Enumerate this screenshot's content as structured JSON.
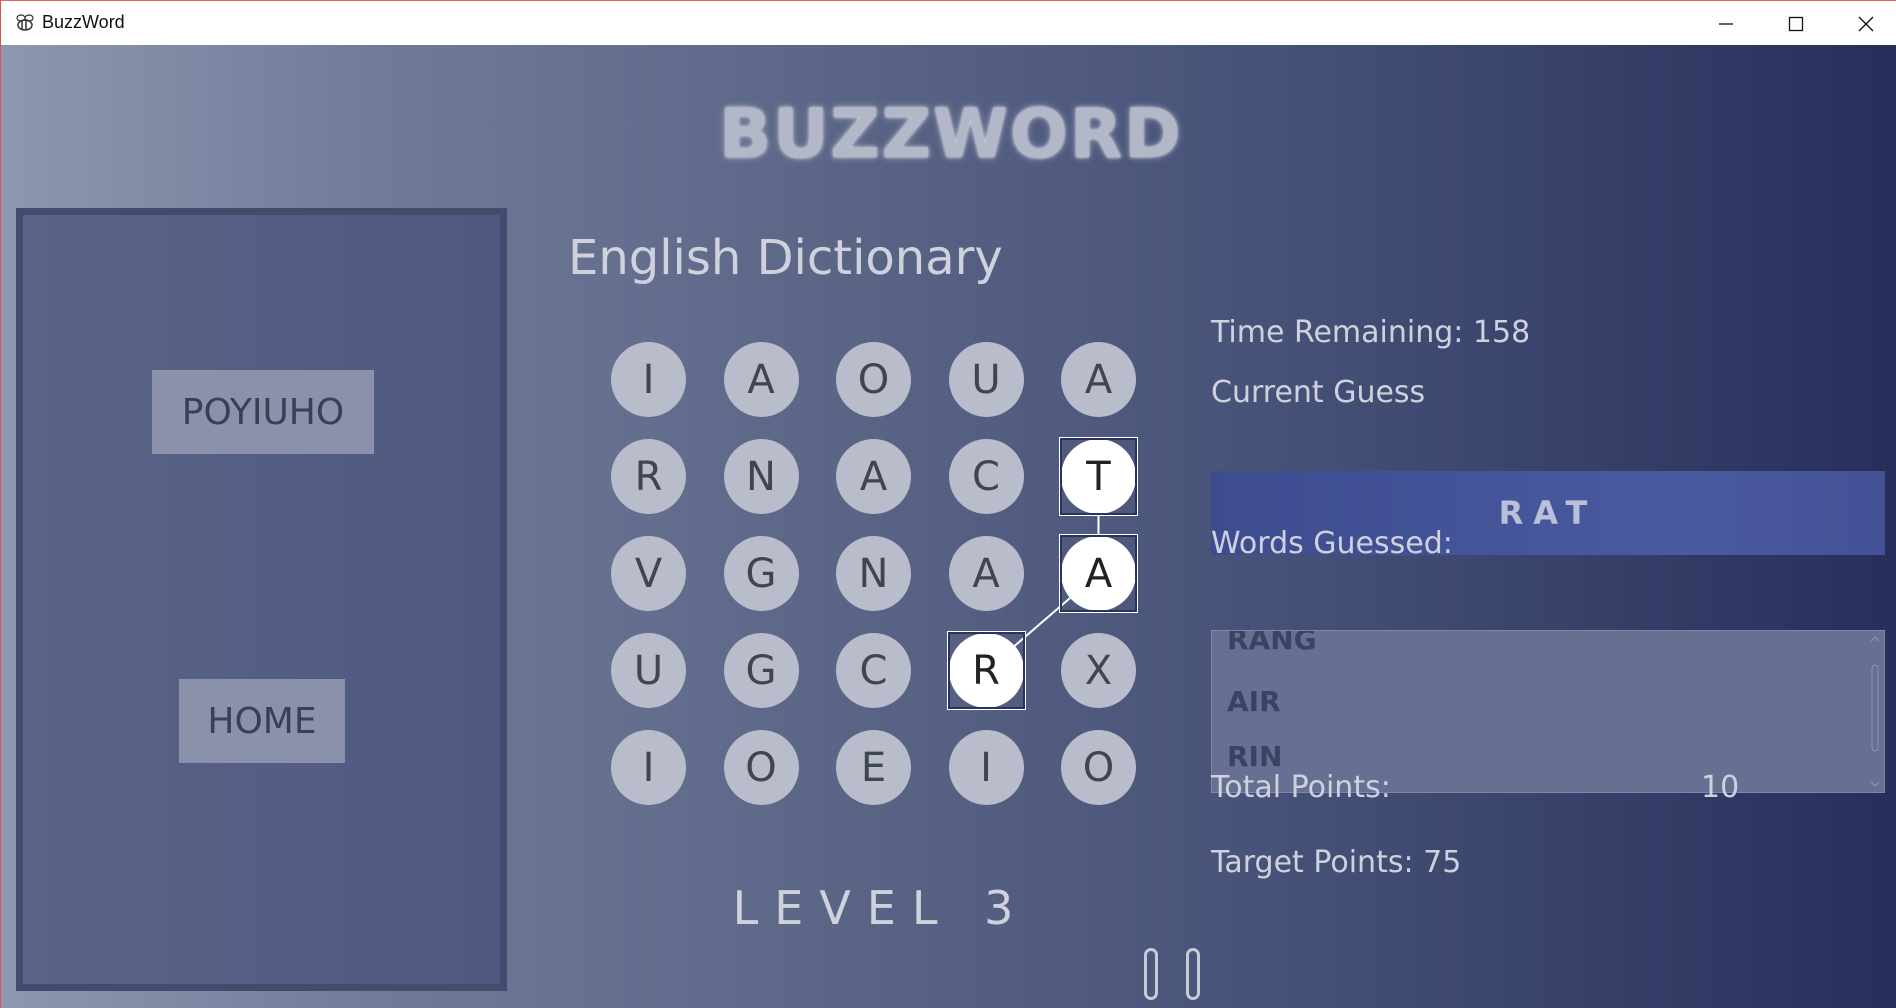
{
  "window": {
    "title": "BuzzWord"
  },
  "app": {
    "logo": "BUZZWORD",
    "mode": "English Dictionary",
    "level": "LEVEL 3"
  },
  "sidebar": {
    "user_button": "POYIUHO",
    "home_button": "HOME"
  },
  "grid": {
    "rows": [
      [
        "I",
        "A",
        "O",
        "U",
        "A"
      ],
      [
        "R",
        "N",
        "A",
        "C",
        "T"
      ],
      [
        "V",
        "G",
        "N",
        "A",
        "A"
      ],
      [
        "U",
        "G",
        "C",
        "R",
        "X"
      ],
      [
        "I",
        "O",
        "E",
        "I",
        "O"
      ]
    ],
    "selected_path": [
      [
        1,
        4
      ],
      [
        2,
        4
      ],
      [
        3,
        3
      ]
    ]
  },
  "info": {
    "time_label": "Time Remaining: 158",
    "current_guess_label": "Current Guess",
    "current_guess": "RAT",
    "words_guessed_label": "Words Guessed:",
    "words_guessed": [
      "RANG",
      "AIR",
      "RIN"
    ],
    "total_points_label": "Total Points:",
    "total_points": "10",
    "target_points_label": "Target Points: 75"
  }
}
